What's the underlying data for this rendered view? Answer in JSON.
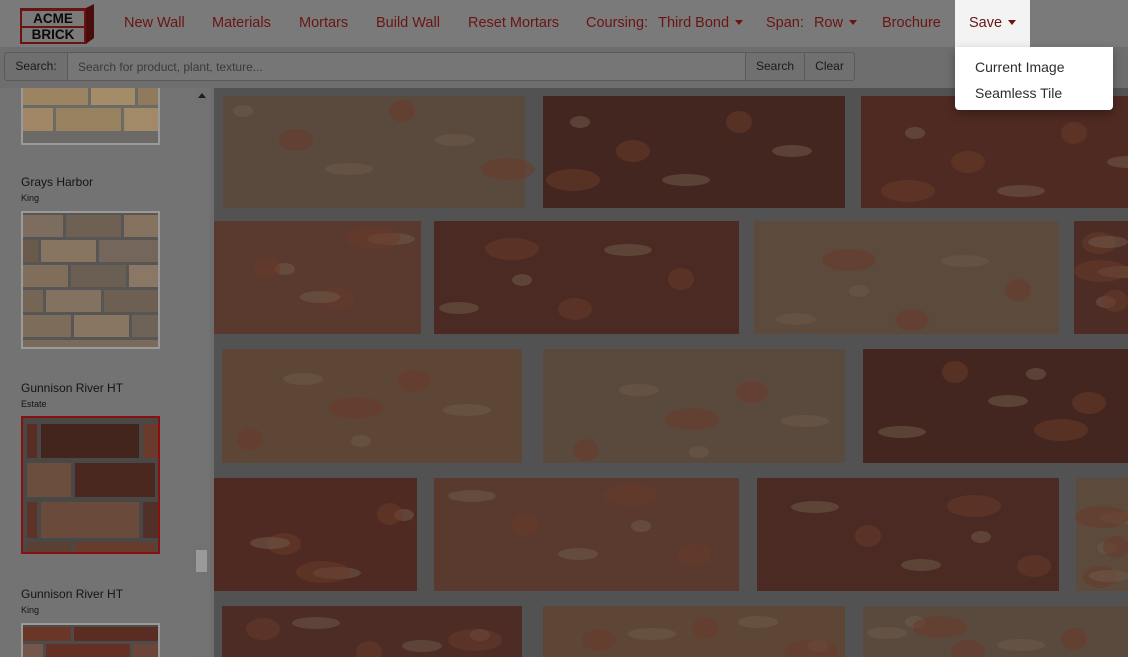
{
  "brand": {
    "logo_line1": "ACME",
    "logo_line2": "BRICK",
    "color": "#6a1514"
  },
  "nav": {
    "items": [
      "New Wall",
      "Materials",
      "Mortars",
      "Build Wall",
      "Reset Mortars"
    ],
    "coursing_label": "Coursing:",
    "coursing_value": "Third Bond",
    "span_label": "Span:",
    "span_value": "Row",
    "brochure": "Brochure",
    "save": "Save"
  },
  "save_menu": {
    "items": [
      "Current Image",
      "Seamless Tile"
    ]
  },
  "search": {
    "label": "Search:",
    "placeholder": "Search for product, plant, texture...",
    "value": "",
    "search_button": "Search",
    "clear_button": "Clear"
  },
  "sidebar": {
    "products": [
      {
        "name": "Grays Harbor",
        "size": "King",
        "selected": false
      },
      {
        "name": "Gunnison River HT",
        "size": "Estate",
        "selected": true
      },
      {
        "name": "Gunnison River HT",
        "size": "King",
        "selected": false
      }
    ]
  },
  "colors": {
    "accent": "#6a1514",
    "selected_border": "#8a1010",
    "mortar": "#525252"
  }
}
